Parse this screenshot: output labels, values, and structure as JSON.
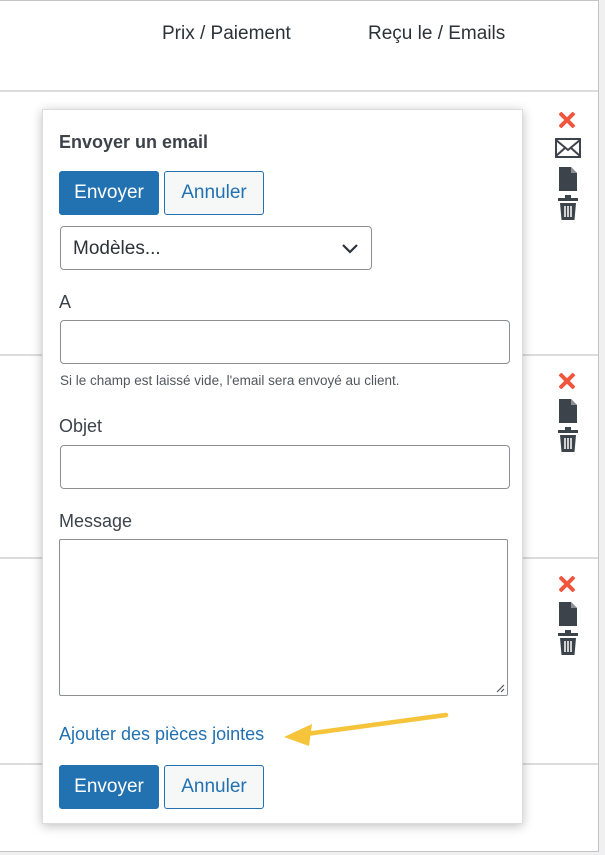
{
  "table": {
    "columns": [
      "Prix / Paiement",
      "Reçu le / Emails"
    ]
  },
  "icons": {
    "delete": "x-icon",
    "mail": "mail-icon",
    "document": "document-icon",
    "trash": "trash-icon",
    "delete_color": "#f0553d"
  },
  "popup": {
    "title": "Envoyer un email",
    "send_label": "Envoyer",
    "cancel_label": "Annuler",
    "templates_select": "Modèles...",
    "to_label": "A",
    "to_value": "",
    "to_hint": "Si le champ est laissé vide, l'email sera envoyé au client.",
    "subject_label": "Objet",
    "subject_value": "",
    "message_label": "Message",
    "message_value": "",
    "attachments_link": "Ajouter des pièces jointes"
  },
  "colors": {
    "primary": "#2271b1",
    "annotation_arrow": "#f5c43b"
  }
}
